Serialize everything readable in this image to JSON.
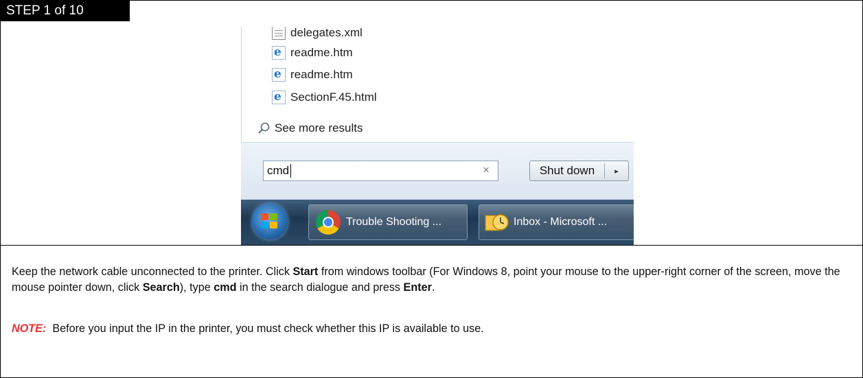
{
  "step": {
    "title": "STEP 1 of 10"
  },
  "screenshot": {
    "files": [
      {
        "name": "delegates.xml",
        "icon": "xml-file-icon"
      },
      {
        "name": "readme.htm",
        "icon": "ie-document-icon"
      },
      {
        "name": "readme.htm",
        "icon": "ie-document-icon"
      },
      {
        "name": "SectionF.45.html",
        "icon": "ie-document-icon"
      }
    ],
    "see_more": "See more results",
    "search_value": "cmd",
    "clear_glyph": "×",
    "shutdown_label": "Shut down",
    "shutdown_arrow": "▸",
    "taskbar": [
      {
        "label": "Trouble Shooting ...",
        "icon": "chrome-icon"
      },
      {
        "label": "Inbox - Microsoft ...",
        "icon": "outlook-icon"
      }
    ]
  },
  "instructions": {
    "p1": [
      {
        "text": "Keep the network cable unconnected to the printer. Click ",
        "bold": false
      },
      {
        "text": "Start",
        "bold": true
      },
      {
        "text": " from windows toolbar (For Windows 8, point your mouse to the upper-right corner of the screen, move the mouse pointer down, click ",
        "bold": false
      },
      {
        "text": "Search",
        "bold": true
      },
      {
        "text": "), type ",
        "bold": false
      },
      {
        "text": "cmd",
        "bold": true
      },
      {
        "text": " in the search dialogue and press ",
        "bold": false
      },
      {
        "text": "Enter",
        "bold": true
      },
      {
        "text": ".",
        "bold": false
      }
    ],
    "note_label": "NOTE:",
    "note_text": "  Before you input the IP in the printer, you must check whether this IP is available to use."
  },
  "colors": {
    "note": "#e8322f",
    "header_bg": "#000000",
    "taskbar": "#1d3852"
  }
}
